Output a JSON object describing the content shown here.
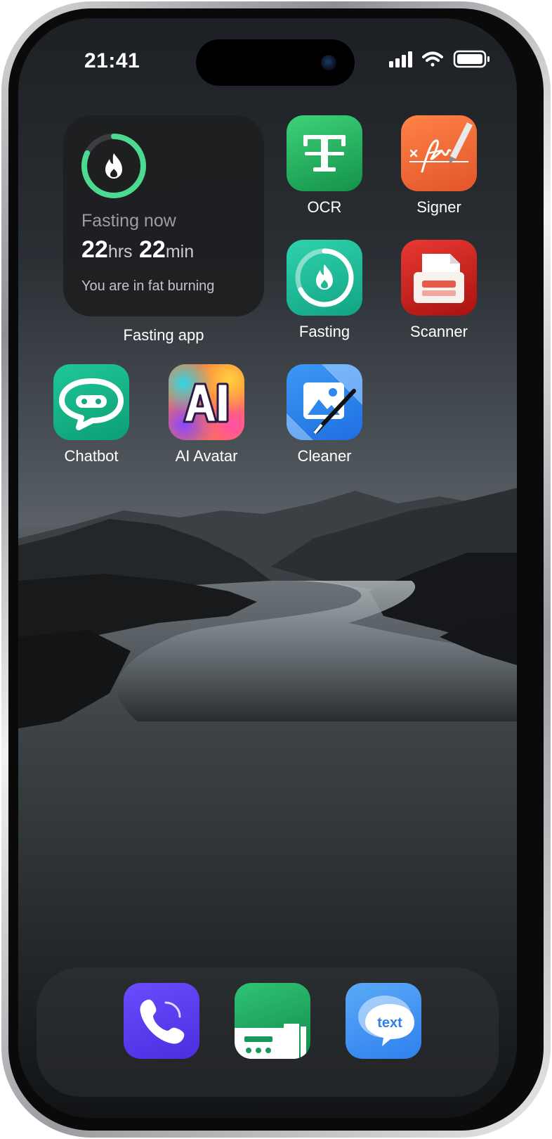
{
  "status_bar": {
    "time": "21:41"
  },
  "widget": {
    "status_label": "Fasting now",
    "hours_value": "22",
    "hours_unit": "hrs",
    "minutes_value": "22",
    "minutes_unit": "min",
    "subtitle": "You are in fat burning",
    "caption": "Fasting app",
    "progress": 0.82,
    "ring_color": "#4cd990"
  },
  "apps": [
    {
      "label": "OCR",
      "icon": "ocr-text-icon",
      "color": "#20a85a"
    },
    {
      "label": "Signer",
      "icon": "signature-pen-icon",
      "color": "#f06a3a"
    },
    {
      "label": "Fasting",
      "icon": "fasting-flame-icon",
      "color": "#22b99a"
    },
    {
      "label": "Scanner",
      "icon": "scanner-icon",
      "color": "#c81f1f"
    },
    {
      "label": "Chatbot",
      "icon": "chatbot-bubble-icon",
      "color": "#16b58a"
    },
    {
      "label": "AI Avatar",
      "icon": "ai-avatar-icon",
      "color": "#ff7a3d"
    },
    {
      "label": "Cleaner",
      "icon": "photo-cleaner-icon",
      "color": "#2f8cf0"
    }
  ],
  "dock": [
    {
      "icon": "phone-call-icon",
      "color": "#5b3cf2"
    },
    {
      "icon": "fax-machine-icon",
      "color": "#19a65c"
    },
    {
      "icon": "text-message-icon",
      "color": "#3b8ff2"
    }
  ],
  "dock_text": "text"
}
